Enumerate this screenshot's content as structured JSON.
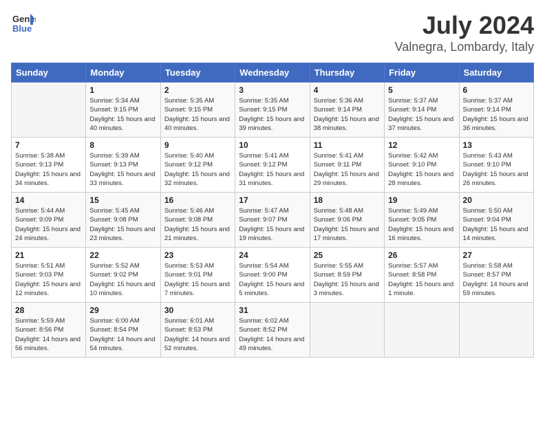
{
  "header": {
    "logo_line1": "General",
    "logo_line2": "Blue",
    "month_year": "July 2024",
    "location": "Valnegra, Lombardy, Italy"
  },
  "weekdays": [
    "Sunday",
    "Monday",
    "Tuesday",
    "Wednesday",
    "Thursday",
    "Friday",
    "Saturday"
  ],
  "weeks": [
    [
      {
        "day": "",
        "sunrise": "",
        "sunset": "",
        "daylight": ""
      },
      {
        "day": "1",
        "sunrise": "Sunrise: 5:34 AM",
        "sunset": "Sunset: 9:15 PM",
        "daylight": "Daylight: 15 hours and 40 minutes."
      },
      {
        "day": "2",
        "sunrise": "Sunrise: 5:35 AM",
        "sunset": "Sunset: 9:15 PM",
        "daylight": "Daylight: 15 hours and 40 minutes."
      },
      {
        "day": "3",
        "sunrise": "Sunrise: 5:35 AM",
        "sunset": "Sunset: 9:15 PM",
        "daylight": "Daylight: 15 hours and 39 minutes."
      },
      {
        "day": "4",
        "sunrise": "Sunrise: 5:36 AM",
        "sunset": "Sunset: 9:14 PM",
        "daylight": "Daylight: 15 hours and 38 minutes."
      },
      {
        "day": "5",
        "sunrise": "Sunrise: 5:37 AM",
        "sunset": "Sunset: 9:14 PM",
        "daylight": "Daylight: 15 hours and 37 minutes."
      },
      {
        "day": "6",
        "sunrise": "Sunrise: 5:37 AM",
        "sunset": "Sunset: 9:14 PM",
        "daylight": "Daylight: 15 hours and 36 minutes."
      }
    ],
    [
      {
        "day": "7",
        "sunrise": "Sunrise: 5:38 AM",
        "sunset": "Sunset: 9:13 PM",
        "daylight": "Daylight: 15 hours and 34 minutes."
      },
      {
        "day": "8",
        "sunrise": "Sunrise: 5:39 AM",
        "sunset": "Sunset: 9:13 PM",
        "daylight": "Daylight: 15 hours and 33 minutes."
      },
      {
        "day": "9",
        "sunrise": "Sunrise: 5:40 AM",
        "sunset": "Sunset: 9:12 PM",
        "daylight": "Daylight: 15 hours and 32 minutes."
      },
      {
        "day": "10",
        "sunrise": "Sunrise: 5:41 AM",
        "sunset": "Sunset: 9:12 PM",
        "daylight": "Daylight: 15 hours and 31 minutes."
      },
      {
        "day": "11",
        "sunrise": "Sunrise: 5:41 AM",
        "sunset": "Sunset: 9:11 PM",
        "daylight": "Daylight: 15 hours and 29 minutes."
      },
      {
        "day": "12",
        "sunrise": "Sunrise: 5:42 AM",
        "sunset": "Sunset: 9:10 PM",
        "daylight": "Daylight: 15 hours and 28 minutes."
      },
      {
        "day": "13",
        "sunrise": "Sunrise: 5:43 AM",
        "sunset": "Sunset: 9:10 PM",
        "daylight": "Daylight: 15 hours and 26 minutes."
      }
    ],
    [
      {
        "day": "14",
        "sunrise": "Sunrise: 5:44 AM",
        "sunset": "Sunset: 9:09 PM",
        "daylight": "Daylight: 15 hours and 24 minutes."
      },
      {
        "day": "15",
        "sunrise": "Sunrise: 5:45 AM",
        "sunset": "Sunset: 9:08 PM",
        "daylight": "Daylight: 15 hours and 23 minutes."
      },
      {
        "day": "16",
        "sunrise": "Sunrise: 5:46 AM",
        "sunset": "Sunset: 9:08 PM",
        "daylight": "Daylight: 15 hours and 21 minutes."
      },
      {
        "day": "17",
        "sunrise": "Sunrise: 5:47 AM",
        "sunset": "Sunset: 9:07 PM",
        "daylight": "Daylight: 15 hours and 19 minutes."
      },
      {
        "day": "18",
        "sunrise": "Sunrise: 5:48 AM",
        "sunset": "Sunset: 9:06 PM",
        "daylight": "Daylight: 15 hours and 17 minutes."
      },
      {
        "day": "19",
        "sunrise": "Sunrise: 5:49 AM",
        "sunset": "Sunset: 9:05 PM",
        "daylight": "Daylight: 15 hours and 16 minutes."
      },
      {
        "day": "20",
        "sunrise": "Sunrise: 5:50 AM",
        "sunset": "Sunset: 9:04 PM",
        "daylight": "Daylight: 15 hours and 14 minutes."
      }
    ],
    [
      {
        "day": "21",
        "sunrise": "Sunrise: 5:51 AM",
        "sunset": "Sunset: 9:03 PM",
        "daylight": "Daylight: 15 hours and 12 minutes."
      },
      {
        "day": "22",
        "sunrise": "Sunrise: 5:52 AM",
        "sunset": "Sunset: 9:02 PM",
        "daylight": "Daylight: 15 hours and 10 minutes."
      },
      {
        "day": "23",
        "sunrise": "Sunrise: 5:53 AM",
        "sunset": "Sunset: 9:01 PM",
        "daylight": "Daylight: 15 hours and 7 minutes."
      },
      {
        "day": "24",
        "sunrise": "Sunrise: 5:54 AM",
        "sunset": "Sunset: 9:00 PM",
        "daylight": "Daylight: 15 hours and 5 minutes."
      },
      {
        "day": "25",
        "sunrise": "Sunrise: 5:55 AM",
        "sunset": "Sunset: 8:59 PM",
        "daylight": "Daylight: 15 hours and 3 minutes."
      },
      {
        "day": "26",
        "sunrise": "Sunrise: 5:57 AM",
        "sunset": "Sunset: 8:58 PM",
        "daylight": "Daylight: 15 hours and 1 minute."
      },
      {
        "day": "27",
        "sunrise": "Sunrise: 5:58 AM",
        "sunset": "Sunset: 8:57 PM",
        "daylight": "Daylight: 14 hours and 59 minutes."
      }
    ],
    [
      {
        "day": "28",
        "sunrise": "Sunrise: 5:59 AM",
        "sunset": "Sunset: 8:56 PM",
        "daylight": "Daylight: 14 hours and 56 minutes."
      },
      {
        "day": "29",
        "sunrise": "Sunrise: 6:00 AM",
        "sunset": "Sunset: 8:54 PM",
        "daylight": "Daylight: 14 hours and 54 minutes."
      },
      {
        "day": "30",
        "sunrise": "Sunrise: 6:01 AM",
        "sunset": "Sunset: 8:53 PM",
        "daylight": "Daylight: 14 hours and 52 minutes."
      },
      {
        "day": "31",
        "sunrise": "Sunrise: 6:02 AM",
        "sunset": "Sunset: 8:52 PM",
        "daylight": "Daylight: 14 hours and 49 minutes."
      },
      {
        "day": "",
        "sunrise": "",
        "sunset": "",
        "daylight": ""
      },
      {
        "day": "",
        "sunrise": "",
        "sunset": "",
        "daylight": ""
      },
      {
        "day": "",
        "sunrise": "",
        "sunset": "",
        "daylight": ""
      }
    ]
  ]
}
